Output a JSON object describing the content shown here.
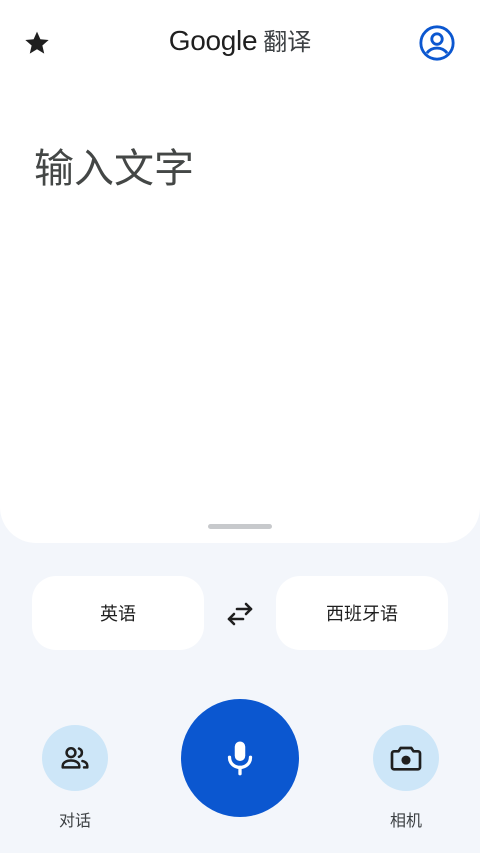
{
  "header": {
    "brand": "Google",
    "product": "翻译",
    "star_icon": "star-icon",
    "profile_icon": "account-circle-icon"
  },
  "input": {
    "placeholder": "输入文字"
  },
  "languages": {
    "source": "英语",
    "target": "西班牙语",
    "swap_icon": "swap-arrows-icon"
  },
  "actions": {
    "conversation_label": "对话",
    "camera_label": "相机",
    "mic_icon": "microphone-icon"
  },
  "colors": {
    "accent": "#0b57d0",
    "chip": "#cde6f8",
    "background": "#f3f6fb"
  }
}
